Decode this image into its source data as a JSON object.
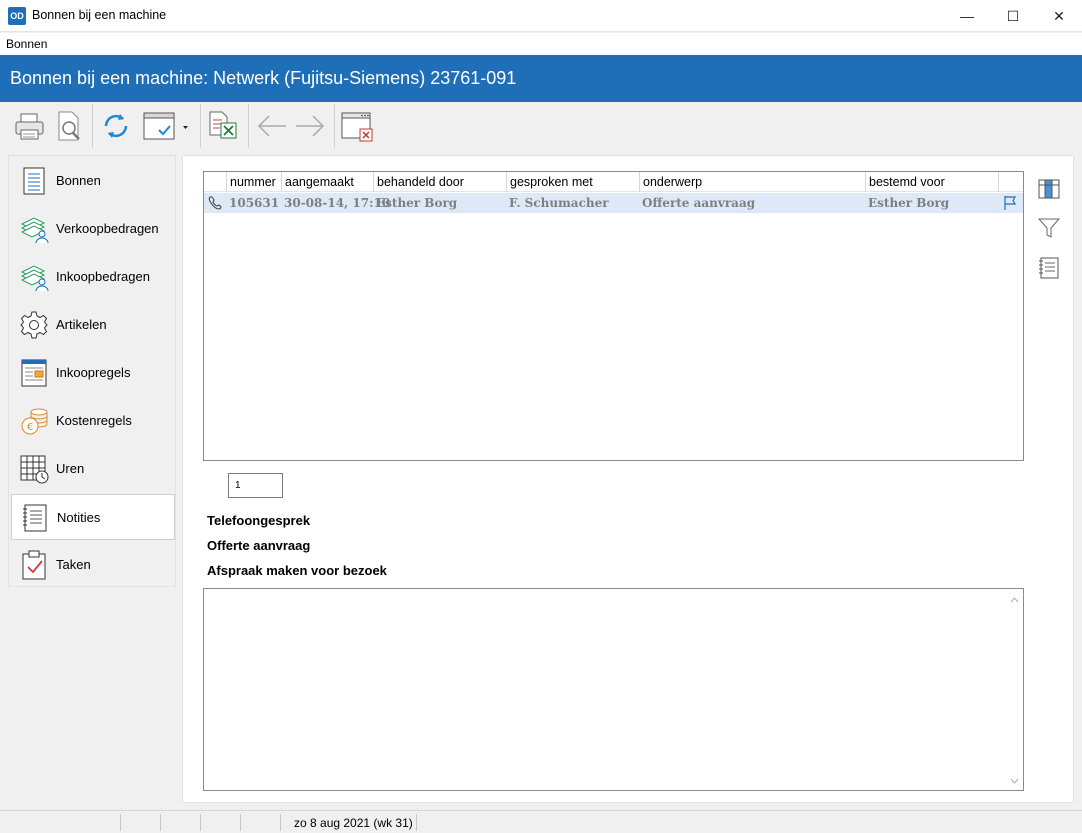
{
  "window": {
    "app_icon": "OD",
    "title": "Bonnen bij een machine",
    "minimize": "—",
    "maximize": "☐",
    "close": "✕"
  },
  "menu": {
    "items": [
      "Bonnen"
    ]
  },
  "header": {
    "title": "Bonnen bij een machine: Netwerk (Fujitsu-Siemens)  23761-091"
  },
  "toolbar": {
    "icons": [
      "printer-icon",
      "print-preview-icon",
      "refresh-icon",
      "view-select-icon",
      "export-excel-icon",
      "arrow-left-icon",
      "arrow-right-icon",
      "close-window-icon"
    ]
  },
  "sidebar": {
    "items": [
      {
        "label": "Bonnen",
        "icon": "document-icon",
        "active": false
      },
      {
        "label": "Verkoopbedragen",
        "icon": "money-person-icon",
        "active": false
      },
      {
        "label": "Inkoopbedragen",
        "icon": "money-person-icon",
        "active": false
      },
      {
        "label": "Artikelen",
        "icon": "gear-icon",
        "active": false
      },
      {
        "label": "Inkoopregels",
        "icon": "form-icon",
        "active": false
      },
      {
        "label": "Kostenregels",
        "icon": "coins-icon",
        "active": false
      },
      {
        "label": "Uren",
        "icon": "timesheet-icon",
        "active": false
      },
      {
        "label": "Notities",
        "icon": "notes-icon",
        "active": true
      },
      {
        "label": "Taken",
        "icon": "clipboard-check-icon",
        "active": false
      }
    ]
  },
  "grid": {
    "columns": [
      "nummer",
      "aangemaakt",
      "behandeld door",
      "gesproken met",
      "onderwerp",
      "bestemd voor"
    ],
    "rows": [
      {
        "type_icon": "phone-icon",
        "nummer": "105631",
        "aangemaakt": "30-08-14, 17:10",
        "behandeld_door": "Esther Borg",
        "gesproken_met": "F. Schumacher",
        "onderwerp": "Offerte aanvraag",
        "bestemd_voor": "Esther Borg",
        "flag_icon": "flag-icon"
      }
    ]
  },
  "pager": {
    "value": "1"
  },
  "note": {
    "type": "Telefoongesprek",
    "subject": "Offerte aanvraag",
    "text": "Afspraak maken voor bezoek"
  },
  "memo": {
    "content": ""
  },
  "side_tools": [
    "columns-icon",
    "filter-icon",
    "notebook-icon"
  ],
  "statusbar": {
    "date": "zo 8 aug 2021 (wk 31)"
  },
  "colors": {
    "accent": "#1f6fb8",
    "row_selected": "#dde9f7",
    "row_text": "#7f7f7f"
  }
}
